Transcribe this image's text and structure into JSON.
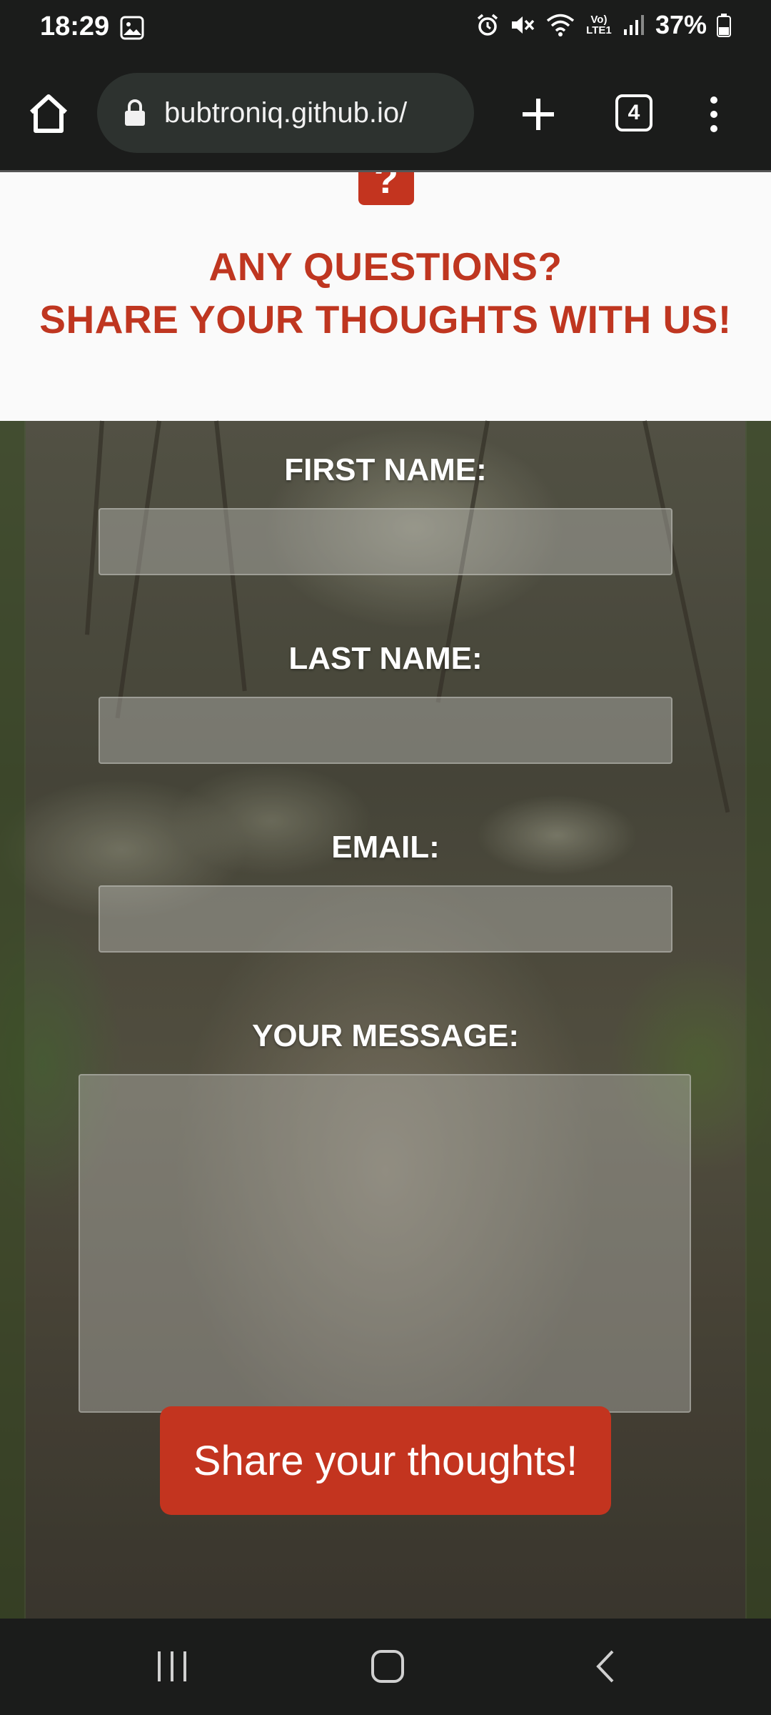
{
  "status_bar": {
    "time": "18:29",
    "network_label": "Vo) LTE1",
    "battery_percent": "37%"
  },
  "browser": {
    "url": "bubtroniq.github.io/",
    "tab_count": "4"
  },
  "page": {
    "badge_symbol": "?",
    "heading_line1": "ANY QUESTIONS?",
    "heading_line2": "SHARE YOUR THOUGHTS WITH US!",
    "form": {
      "first_name_label": "FIRST NAME:",
      "first_name_value": "",
      "last_name_label": "LAST NAME:",
      "last_name_value": "",
      "email_label": "EMAIL:",
      "email_value": "",
      "message_label": "YOUR MESSAGE:",
      "message_value": "",
      "submit_label": "Share your thoughts!"
    }
  },
  "colors": {
    "accent": "#c3341f",
    "heading": "#bf3620",
    "chrome_bg": "#1b1c1b"
  }
}
